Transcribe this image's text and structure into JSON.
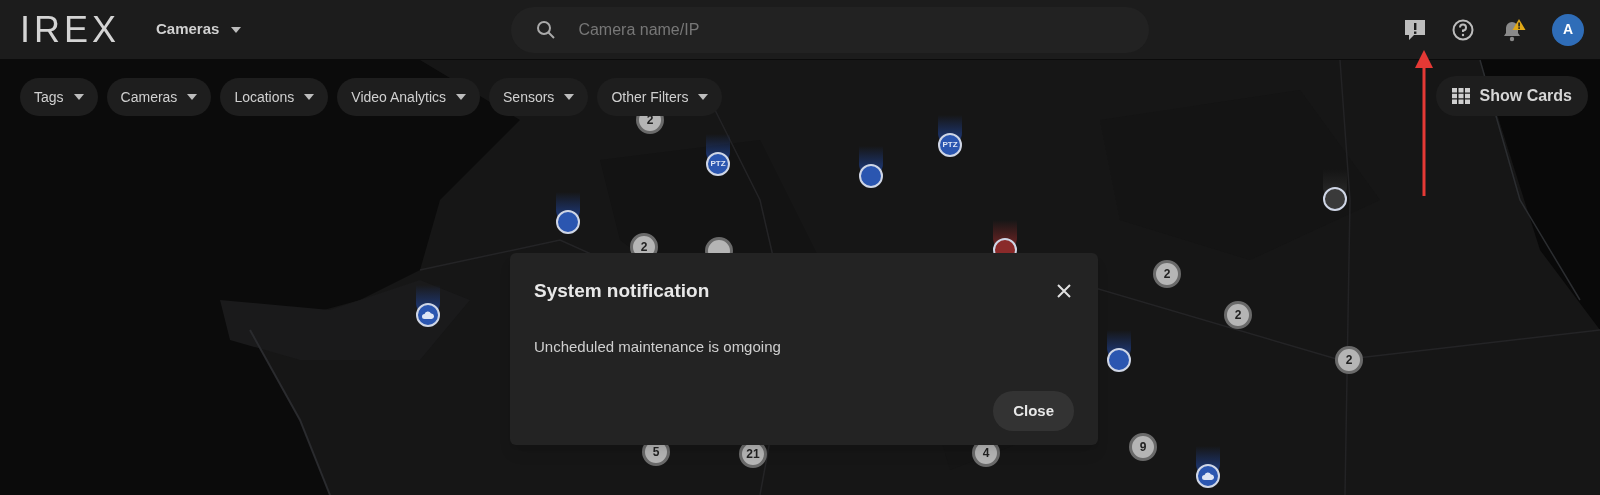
{
  "header": {
    "logo": "IREX",
    "section_menu": "Cameras",
    "search": {
      "placeholder": "Camera name/IP"
    },
    "avatar": "A"
  },
  "filters": [
    "Tags",
    "Cameras",
    "Locations",
    "Video Analytics",
    "Sensors",
    "Other Filters"
  ],
  "show_cards_button": "Show Cards",
  "map": {
    "markers": [
      {
        "kind": "cluster",
        "count": "2"
      },
      {
        "kind": "ptz",
        "label": "PTZ"
      },
      {
        "kind": "ptz",
        "label": "PTZ"
      },
      {
        "kind": "camera"
      },
      {
        "kind": "camera"
      },
      {
        "kind": "cluster",
        "count": "2"
      },
      {
        "kind": "cluster"
      },
      {
        "kind": "alarm"
      },
      {
        "kind": "cloud"
      },
      {
        "kind": "offline"
      },
      {
        "kind": "cluster",
        "count": "2"
      },
      {
        "kind": "cluster",
        "count": "2"
      },
      {
        "kind": "camera"
      },
      {
        "kind": "cluster",
        "count": "2"
      },
      {
        "kind": "cluster",
        "count": "5"
      },
      {
        "kind": "cluster",
        "count": "21"
      },
      {
        "kind": "cluster",
        "count": "4"
      },
      {
        "kind": "cluster",
        "count": "9"
      },
      {
        "kind": "cloud"
      }
    ]
  },
  "dialog": {
    "title": "System notification",
    "message": "Uncheduled maintenance is omgoing",
    "close_button": "Close"
  }
}
